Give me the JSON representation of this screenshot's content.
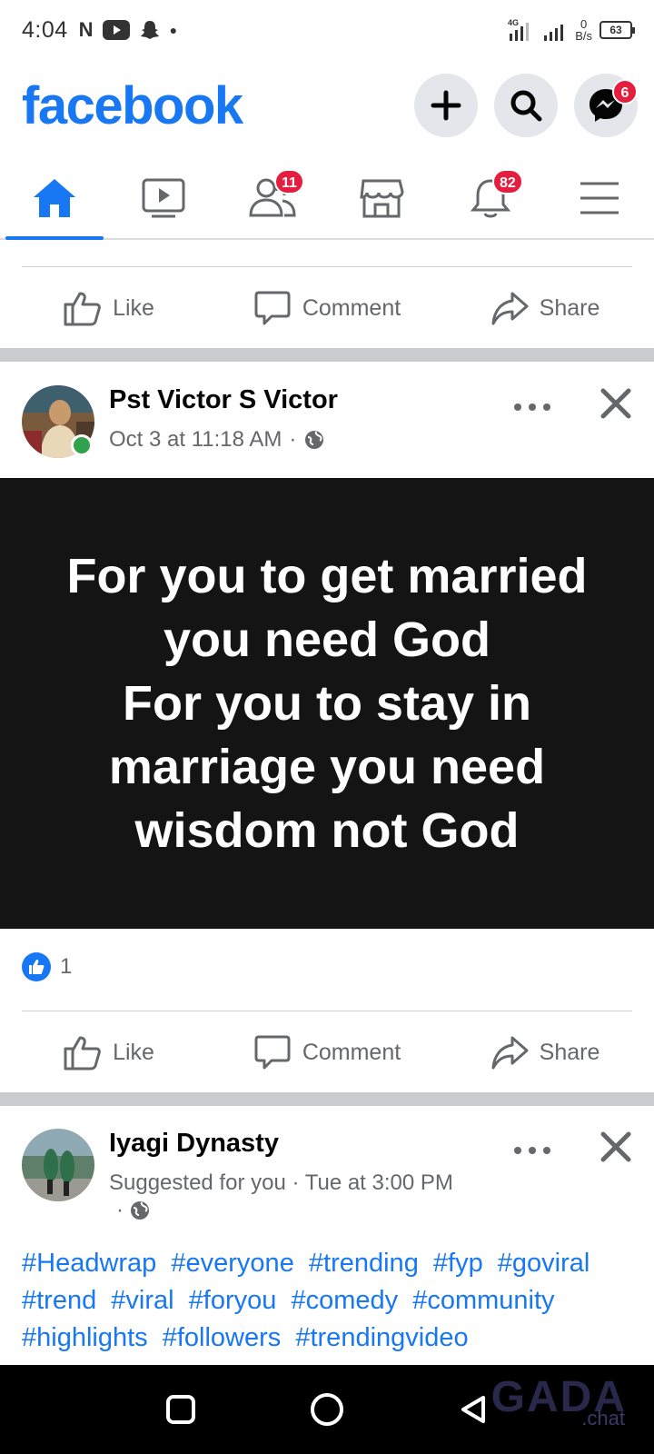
{
  "status_bar": {
    "time": "4:04",
    "network": "4G",
    "speed_value": "0",
    "speed_unit": "B/s",
    "battery": "63"
  },
  "header": {
    "logo": "facebook",
    "messenger_badge": "6"
  },
  "tabs": {
    "friends_badge": "11",
    "notifications_badge": "82"
  },
  "actions": {
    "like": "Like",
    "comment": "Comment",
    "share": "Share"
  },
  "post1": {
    "author": "Pst Victor S Victor",
    "timestamp": "Oct 3 at 11:18 AM",
    "image_text": "For you to get married\nyou need God\nFor you to stay in\nmarriage you need\nwisdom  not God",
    "reactions_count": "1"
  },
  "post2": {
    "author": "Iyagi Dynasty",
    "meta": "Suggested for you · Tue at 3:00 PM",
    "hashtags": [
      "#Headwrap",
      "#everyone",
      "#trending",
      "#fyp",
      "#goviral",
      "#trend",
      "#viral",
      "#foryou",
      "#comedy",
      "#community",
      "#highlights",
      "#followers",
      "#trendingvideo"
    ]
  },
  "colors": {
    "brand": "#1877f2",
    "badge": "#e41e3f",
    "muted_text": "#65676b",
    "online": "#31a24c"
  },
  "watermark": {
    "main": "GADA",
    "sub": ".chat"
  }
}
